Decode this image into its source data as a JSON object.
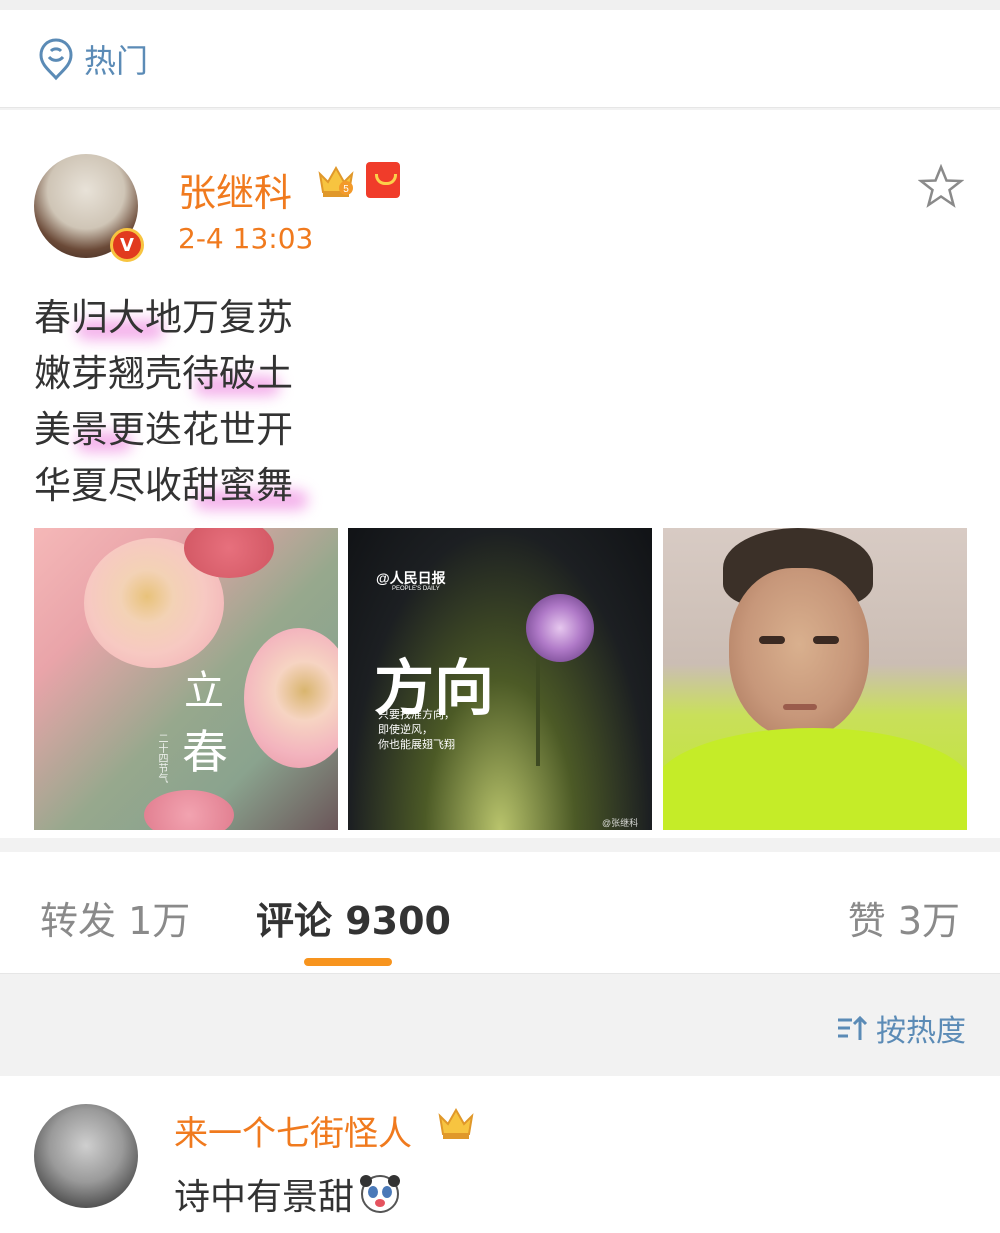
{
  "header": {
    "hot_label": "热门"
  },
  "post": {
    "username": "张继科",
    "timestamp": "2-4 13:03",
    "verified_badge": "V",
    "poem_lines": [
      "春归大地万复苏",
      "嫩芽翘壳待破土",
      "美景更迭花世开",
      "华夏尽收甜蜜舞"
    ],
    "photos": [
      {
        "text_a": "立",
        "text_b": "春",
        "small": "二十四节气"
      },
      {
        "brand": "@人民日报",
        "brand_sub": "PEOPLE'S DAILY",
        "title": "方向",
        "caption": [
          "只要找准方向，",
          "即使逆风，",
          "你也能展翅飞翔"
        ],
        "watermark": "@张继科"
      },
      {}
    ]
  },
  "tabs": {
    "repost": "转发 1万",
    "comment": "评论 9300",
    "like": "赞 3万"
  },
  "sort": {
    "label": "按热度"
  },
  "comment": {
    "username": "来一个七街怪人",
    "text": "诗中有景甜"
  },
  "colors": {
    "accent": "#f07a1e",
    "link": "#5b8bb6",
    "tab_indicator": "#f7941e"
  }
}
